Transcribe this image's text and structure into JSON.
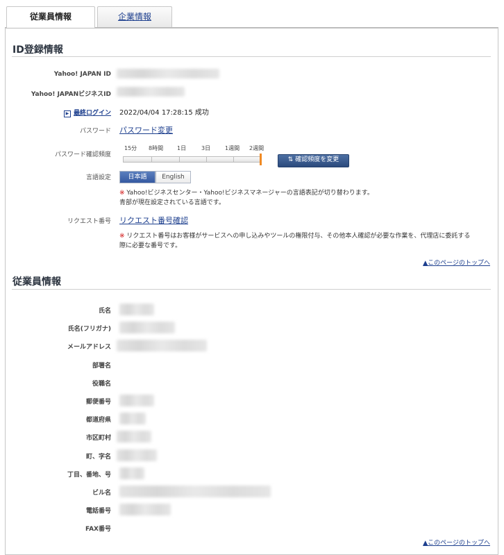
{
  "tabs": {
    "active": "従業員情報",
    "inactive": "企業情報"
  },
  "id_section": {
    "title": "ID登録情報",
    "labels": {
      "yahoo_id": "Yahoo! JAPAN ID",
      "business_id": "Yahoo! JAPANビジネスID",
      "last_login": "最終ログイン",
      "password": "パスワード",
      "password_freq": "パスワード確認頻度",
      "language": "言語設定",
      "request_no": "リクエスト番号"
    },
    "last_login_value": "2022/04/04 17:28:15 成功",
    "password_link": "パスワード変更",
    "freq_ticks": [
      "15分",
      "8時間",
      "1日",
      "3日",
      "1週間",
      "2週間"
    ],
    "freq_selected_index": 5,
    "freq_button": "確認頻度を変更",
    "lang_options": [
      "日本語",
      "English"
    ],
    "lang_selected": "日本語",
    "lang_note_mark": "※",
    "lang_note_1": "Yahoo!ビジネスセンター・Yahoo!ビジネスマネージャーの言語表記が切り替わります。",
    "lang_note_2": "青部が現在設定されている言語です。",
    "request_link": "リクエスト番号確認",
    "request_note_mark": "※",
    "request_note_1": "リクエスト番号はお客様がサービスへの申し込みやツールの権限付与、その他本人確認が必要な作業を、代理店に委託する",
    "request_note_2": "際に必要な番号です。"
  },
  "page_top_link": "▲このページのトップへ",
  "emp_section": {
    "title": "従業員情報",
    "labels": [
      "氏名",
      "氏名(フリガナ)",
      "メールアドレス",
      "部署名",
      "役職名",
      "郵便番号",
      "都道府県",
      "市区町村",
      "町、字名",
      "丁目、番地、号",
      "ビル名",
      "電話番号",
      "FAX番号"
    ]
  },
  "colors": {
    "link": "#1d3f8e",
    "accent": "#f08a24",
    "button": "#2b4a7c",
    "note_mark": "#cc0000"
  }
}
